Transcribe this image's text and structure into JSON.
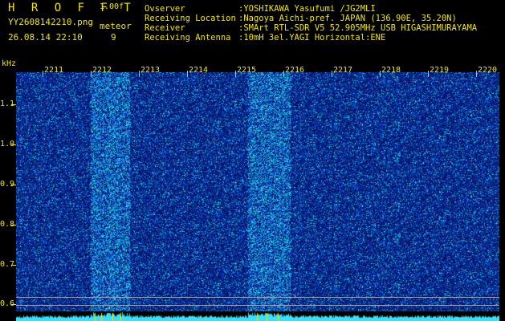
{
  "header": {
    "brand": "H R O F F T",
    "version": "1.00f",
    "filename": "YY2608142210.png",
    "datetime": "26.08.14 22:10",
    "meteor_label": "meteor",
    "meteor_count": "9",
    "info": [
      {
        "key": "Ovserver",
        "value": ":YOSHIKAWA Yasufumi /JG2MLI"
      },
      {
        "key": "Receiving Location",
        "value": ":Nagoya Aichi-pref. JAPAN (136.90E, 35.20N)"
      },
      {
        "key": "Receiver",
        "value": ":SMArt RTL-SDR V5 52.905MHz USB HIGASHIMURAYAMA"
      },
      {
        "key": "Receiving Antenna",
        "value": ":10mH 3el.YAGI Horizontal:ENE"
      }
    ]
  },
  "axis": {
    "unit": "kHz",
    "y_ticks": [
      "1.1",
      "1.0",
      "0.9",
      "0.8",
      "0.7",
      "0.6"
    ],
    "x_ticks": [
      "2211",
      "2212",
      "2213",
      "2214",
      "2215",
      "2216",
      "2217",
      "2218",
      "2219",
      "2220"
    ]
  },
  "colors": {
    "text": "#f2e600",
    "background": "#000000",
    "noise": "#0a1a9a",
    "signal": "#36e0ff"
  }
}
